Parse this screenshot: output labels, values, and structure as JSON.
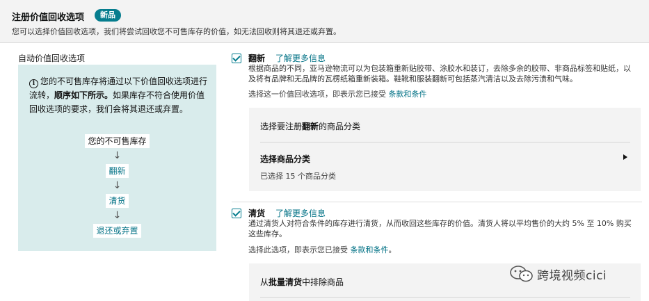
{
  "header": {
    "title": "注册价值回收选项",
    "badge": "新品",
    "subtitle": "您可以选择价值回收选项，我们将尝试回收您不可售库存的价值，如无法回收则将其退还或弃置。"
  },
  "left": {
    "label": "自动价值回收选项",
    "info_a": "您的不可售库存将通过以下价值回收选项进行流转，",
    "info_bold": "顺序如下所示。",
    "info_b": "如果库存不符合使用价值回收选项的要求，我们会将其退还或弃置。",
    "flow": [
      "您的不可售库存",
      "翻新",
      "清货",
      "退还或弃置"
    ]
  },
  "refurb": {
    "title": "翻新",
    "link": "了解更多信息",
    "desc": "根据商品的不同，亚马逊物流可以为包装箱重新贴胶带、涂胶水和装订，去除多余的胶带、非商品标签和贴纸，以及将有品牌和无品牌的瓦楞纸箱重新装箱。鞋靴和服装翻新可包括蒸汽清洁以及去除污渍和气味。",
    "accept_text": "选择这一价值回收选项，即表示您已接受",
    "accept_link": "条款和条件",
    "box_heading_a": "选择要注册",
    "box_heading_bold": "翻新",
    "box_heading_b": "的商品分类",
    "select_label": "选择商品分类",
    "selected_count": "已选择 15 个商品分类"
  },
  "liquidation": {
    "title": "清货",
    "link": "了解更多信息",
    "desc": "通过清货人对符合条件的库存进行清货，从而收回这些库存的价值。清货人将以平均售价的大约 5% 至 10% 购买这些库存。",
    "accept_text": "选择此选项，即表示您已接受",
    "accept_link": "条款和条件",
    "accept_suffix": "。",
    "box_heading_a": "从",
    "box_heading_bold": "批量清货",
    "box_heading_b": "中排除商品"
  },
  "watermark": {
    "text": "跨境视频cici"
  },
  "colors": {
    "accent": "#067d8e",
    "link": "#007185",
    "panel": "#d9ecec"
  }
}
